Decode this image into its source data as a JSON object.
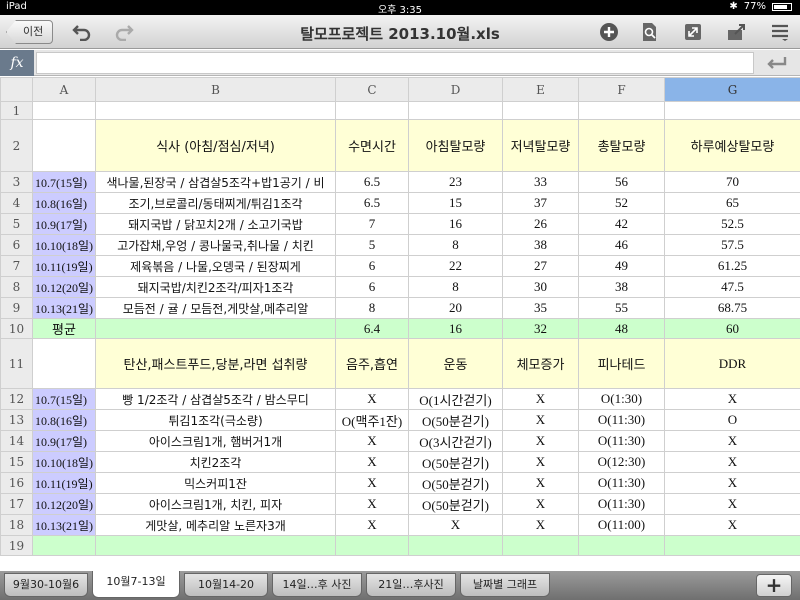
{
  "status_bar": {
    "device": "iPad",
    "time": "오후 3:35",
    "battery": "77%"
  },
  "nav": {
    "back_label": "이전",
    "title": "탈모프로젝트 2013.10월.xls"
  },
  "formula_bar": {
    "fx_label": "fx",
    "value": ""
  },
  "icons": [
    "undo-icon",
    "redo-icon",
    "add-icon",
    "search-document-icon",
    "fullscreen-icon",
    "share-icon",
    "menu-icon",
    "enter-icon"
  ],
  "columns": [
    "A",
    "B",
    "C",
    "D",
    "E",
    "F",
    "G"
  ],
  "selected_column": "G",
  "rows": [
    {
      "n": "1",
      "a": "",
      "b": "",
      "c": "",
      "d": "",
      "e": "",
      "f": "",
      "g": ""
    },
    {
      "n": "2",
      "a": "",
      "b": "식사 (아침/점심/저녁)",
      "c": "수면시간",
      "d": "아침탈모량",
      "e": "저녁탈모량",
      "f": "총탈모량",
      "g": "하루예상탈모량"
    },
    {
      "n": "3",
      "a": "10.7(15일)",
      "b": "색나물,된장국 / 삼겹살5조각+밥1공기 / 비",
      "c": "6.5",
      "d": "23",
      "e": "33",
      "f": "56",
      "g": "70"
    },
    {
      "n": "4",
      "a": "10.8(16일)",
      "b": "조기,브로콜리/동태찌게/튀김1조각",
      "c": "6.5",
      "d": "15",
      "e": "37",
      "f": "52",
      "g": "65"
    },
    {
      "n": "5",
      "a": "10.9(17일)",
      "b": "돼지국밥 / 닭꼬치2개 / 소고기국밥",
      "c": "7",
      "d": "16",
      "e": "26",
      "f": "42",
      "g": "52.5"
    },
    {
      "n": "6",
      "a": "10.10(18일)",
      "b": "고가잡채,우엉 / 콩나물국,취나물 / 치킨",
      "c": "5",
      "d": "8",
      "e": "38",
      "f": "46",
      "g": "57.5"
    },
    {
      "n": "7",
      "a": "10.11(19일)",
      "b": "제육볶음 / 나물,오뎅국 / 된장찌게",
      "c": "6",
      "d": "22",
      "e": "27",
      "f": "49",
      "g": "61.25"
    },
    {
      "n": "8",
      "a": "10.12(20일)",
      "b": "돼지국밥/치킨2조각/피자1조각",
      "c": "6",
      "d": "8",
      "e": "30",
      "f": "38",
      "g": "47.5"
    },
    {
      "n": "9",
      "a": "10.13(21일)",
      "b": "모듬전 / 귤 / 모듬전,게맛살,메추리알",
      "c": "8",
      "d": "20",
      "e": "35",
      "f": "55",
      "g": "68.75"
    },
    {
      "n": "10",
      "a": "평균",
      "b": "",
      "c": "6.4",
      "d": "16",
      "e": "32",
      "f": "48",
      "g": "60"
    },
    {
      "n": "11",
      "a": "",
      "b": "탄산,패스트푸드,당분,라면 섭취량",
      "c": "음주,흡연",
      "d": "운동",
      "e": "체모증가",
      "f": "피나테드",
      "g": "DDR"
    },
    {
      "n": "12",
      "a": "10.7(15일)",
      "b": "빵 1/2조각 / 삼겹살5조각 / 밤스무디",
      "c": "X",
      "d": "O(1시간걷기)",
      "e": "X",
      "f": "O(1:30)",
      "g": "X"
    },
    {
      "n": "13",
      "a": "10.8(16일)",
      "b": "튀김1조각(극소량)",
      "c": "O(맥주1잔)",
      "d": "O(50분걷기)",
      "e": "X",
      "f": "O(11:30)",
      "g": "O"
    },
    {
      "n": "14",
      "a": "10.9(17일)",
      "b": "아이스크림1개, 햄버거1개",
      "c": "X",
      "d": "O(3시간걷기)",
      "e": "X",
      "f": "O(11:30)",
      "g": "X"
    },
    {
      "n": "15",
      "a": "10.10(18일)",
      "b": "치킨2조각",
      "c": "X",
      "d": "O(50분걷기)",
      "e": "X",
      "f": "O(12:30)",
      "g": "X"
    },
    {
      "n": "16",
      "a": "10.11(19일)",
      "b": "믹스커피1잔",
      "c": "X",
      "d": "O(50분걷기)",
      "e": "X",
      "f": "O(11:30)",
      "g": "X"
    },
    {
      "n": "17",
      "a": "10.12(20일)",
      "b": "아이스크림1개, 치킨, 피자",
      "c": "X",
      "d": "O(50분걷기)",
      "e": "X",
      "f": "O(11:30)",
      "g": "X"
    },
    {
      "n": "18",
      "a": "10.13(21일)",
      "b": "게맛살, 메추리알 노른자3개",
      "c": "X",
      "d": "X",
      "e": "X",
      "f": "O(11:00)",
      "g": "X"
    },
    {
      "n": "19",
      "a": "",
      "b": "",
      "c": "",
      "d": "",
      "e": "",
      "f": "",
      "g": ""
    }
  ],
  "tabs": [
    {
      "label": "9월30-10월6",
      "active": false
    },
    {
      "label": "10월7-13일",
      "active": true
    },
    {
      "label": "10월14-20",
      "active": false
    },
    {
      "label": "14일…후 사진",
      "active": false
    },
    {
      "label": "21일…후사진",
      "active": false
    },
    {
      "label": "날짜별 그래프",
      "active": false
    }
  ],
  "add_tab_label": "+",
  "colors": {
    "header_fill": "#ffffd6",
    "average_fill": "#ccffcc",
    "date_fill": "#ccccff",
    "selected_column": "#8ab4e8"
  }
}
